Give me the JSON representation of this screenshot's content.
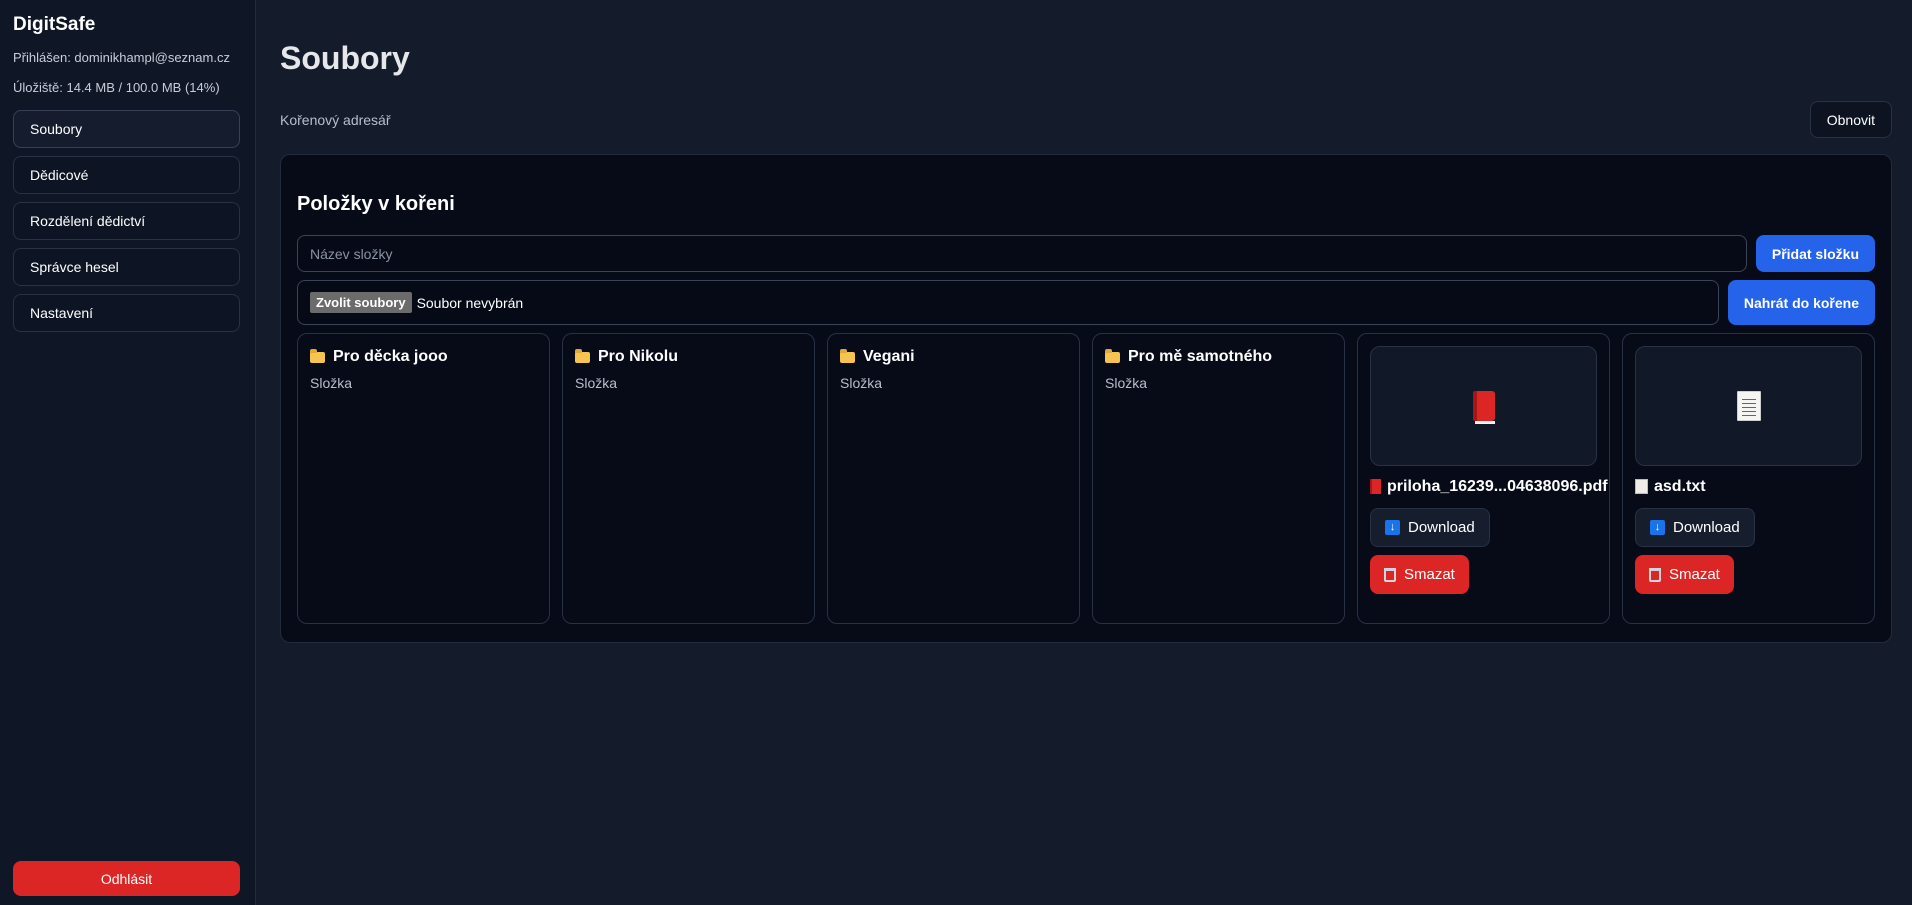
{
  "sidebar": {
    "brand": "DigitSafe",
    "logged_in": "Přihlášen: dominikhampl@seznam.cz",
    "storage": "Úložiště: 14.4 MB / 100.0 MB (14%)",
    "storage_percent": 14,
    "items": [
      {
        "label": "Soubory"
      },
      {
        "label": "Dědicové"
      },
      {
        "label": "Rozdělení dědictví"
      },
      {
        "label": "Správce hesel"
      },
      {
        "label": "Nastavení"
      }
    ],
    "logout_label": "Odhlásit"
  },
  "main": {
    "title": "Soubory",
    "path": "Kořenový adresář",
    "refresh_label": "Obnovit",
    "panel_title": "Položky v kořeni",
    "folder_placeholder": "Název složky",
    "add_folder_label": "Přidat složku",
    "choose_files_label": "Zvolit soubory",
    "no_file_label": "Soubor nevybrán",
    "upload_label": "Nahrát do kořene",
    "folders": [
      {
        "name": "Pro děcka jooo",
        "type": "Složka"
      },
      {
        "name": "Pro Nikolu",
        "type": "Složka"
      },
      {
        "name": "Vegani",
        "type": "Složka"
      },
      {
        "name": "Pro mě samotného",
        "type": "Složka"
      }
    ],
    "files": [
      {
        "name": "priloha_16239...04638096.pdf",
        "icon": "pdf-book-icon",
        "download_label": "Download",
        "delete_label": "Smazat"
      },
      {
        "name": "asd.txt",
        "icon": "text-document-icon",
        "download_label": "Download",
        "delete_label": "Smazat"
      }
    ]
  },
  "colors": {
    "background": "#141b2b",
    "accent": "#2563eb",
    "danger": "#dc2626"
  }
}
